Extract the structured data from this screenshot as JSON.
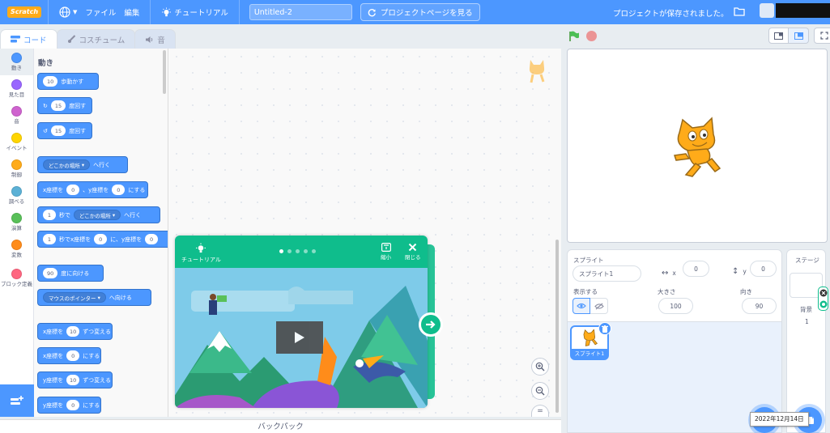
{
  "menubar": {
    "logo_text": "Scratch",
    "language_icon": "globe-icon",
    "file_label": "ファイル",
    "edit_label": "編集",
    "tutorial_label": "チュートリアル",
    "project_title": "Untitled-2",
    "share_label": "プロジェクトページを見る",
    "saved_status": "プロジェクトが保存されました。"
  },
  "tabs": [
    {
      "label": "コード",
      "icon": "code-icon"
    },
    {
      "label": "コスチューム",
      "icon": "brush-icon"
    },
    {
      "label": "音",
      "icon": "speaker-icon"
    }
  ],
  "categories": [
    {
      "label": "動き",
      "color": "#4c97ff"
    },
    {
      "label": "見た目",
      "color": "#9966ff"
    },
    {
      "label": "音",
      "color": "#cf63cf"
    },
    {
      "label": "イベント",
      "color": "#ffd500"
    },
    {
      "label": "制御",
      "color": "#ffab19"
    },
    {
      "label": "調べる",
      "color": "#5cb1d6"
    },
    {
      "label": "演算",
      "color": "#59c059"
    },
    {
      "label": "変数",
      "color": "#ff8c1a"
    },
    {
      "label": "ブロック定義",
      "color": "#ff6680"
    }
  ],
  "palette": {
    "section_title": "動き",
    "blocks": {
      "move": {
        "value": "10",
        "text": "歩動かす"
      },
      "turn_right": {
        "value": "15",
        "text": "度回す"
      },
      "turn_left": {
        "value": "15",
        "text": "度回す"
      },
      "goto": {
        "dropdown": "どこかの場所",
        "text": "へ行く"
      },
      "goto_xy": {
        "t1": "x座標を",
        "x": "0",
        "t2": "、y座標を",
        "y": "0",
        "t3": "にする"
      },
      "glide": {
        "secs": "1",
        "t1": "秒で",
        "dropdown": "どこかの場所",
        "t2": "へ行く"
      },
      "glide_xy": {
        "secs": "1",
        "t1": "秒でx座標を",
        "x": "0",
        "t2": "に、y座標を",
        "y": "0"
      },
      "point_dir": {
        "value": "90",
        "text": "度に向ける"
      },
      "point_towards": {
        "dropdown": "マウスのポインター",
        "text": "へ向ける"
      },
      "change_x": {
        "t1": "x座標を",
        "value": "10",
        "t2": "ずつ変える"
      },
      "set_x": {
        "t1": "x座標を",
        "value": "0",
        "t2": "にする"
      },
      "change_y": {
        "t1": "y座標を",
        "value": "10",
        "t2": "ずつ変える"
      },
      "set_y": {
        "t1": "y座標を",
        "value": "0",
        "t2": "にする"
      }
    }
  },
  "backpack_label": "バックパック",
  "tutorial_card": {
    "title": "チュートリアル",
    "shrink_label": "縮小",
    "close_label": "閉じる",
    "page_dots": 5,
    "active_dot": 1
  },
  "sprite_info": {
    "header": "スプライト",
    "sprite_name": "スプライト1",
    "x_label": "x",
    "x_value": "0",
    "y_label": "y",
    "y_value": "0",
    "show_label": "表示する",
    "size_label": "大きさ",
    "size_value": "100",
    "direction_label": "向き",
    "direction_value": "90"
  },
  "sprite_list": [
    {
      "name": "スプライト1",
      "selected": true
    }
  ],
  "stage_panel": {
    "header": "ステージ",
    "backdrops_label": "背景",
    "backdrops_count": "1"
  },
  "taskbar_tip": "2022年12月14日",
  "colors": {
    "accent": "#4c97ff",
    "tutorial_green": "#0fbd8c",
    "stop_red": "#ec5959"
  }
}
